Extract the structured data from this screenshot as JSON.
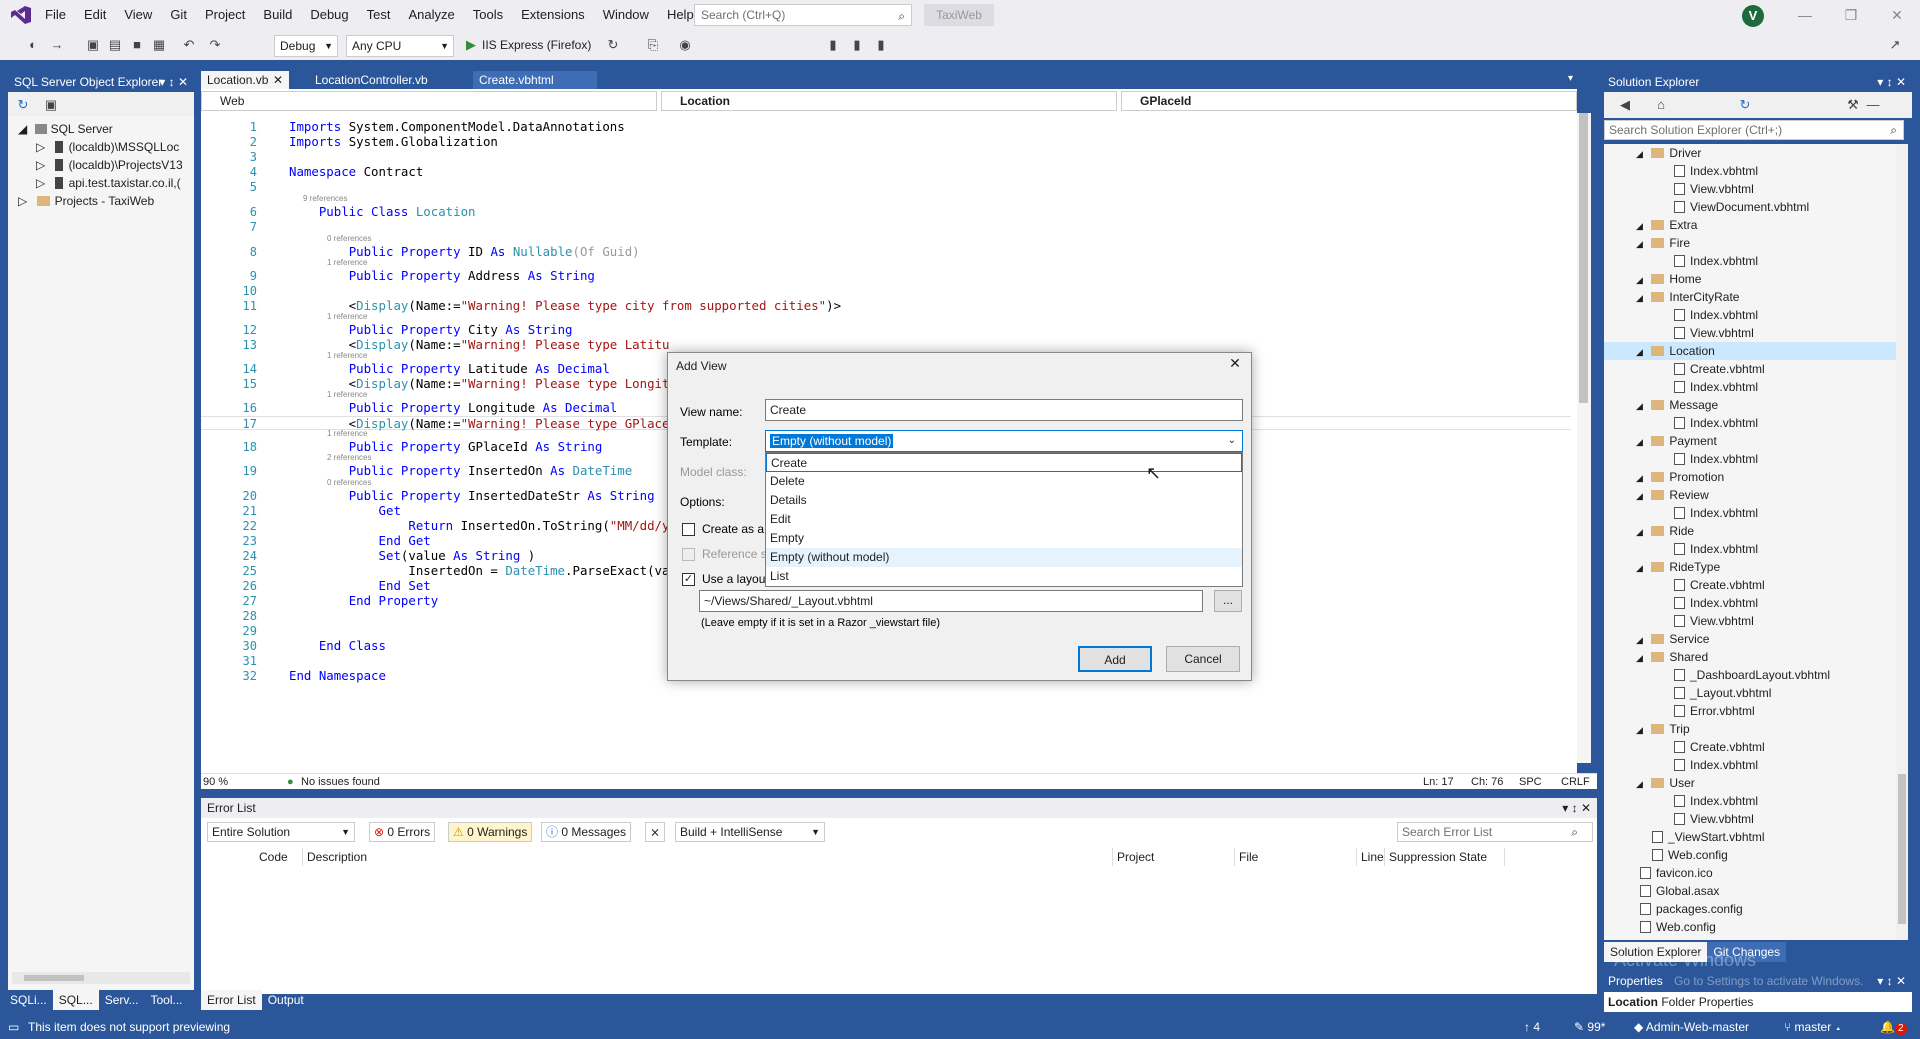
{
  "menu": [
    "File",
    "Edit",
    "View",
    "Git",
    "Project",
    "Build",
    "Debug",
    "Test",
    "Analyze",
    "Tools",
    "Extensions",
    "Window",
    "Help"
  ],
  "search": {
    "placeholder": "Search (Ctrl+Q)"
  },
  "app_title": "TaxiWeb",
  "avatar_initial": "V",
  "toolbar": {
    "config": "Debug",
    "platform": "Any CPU",
    "run_target": "IIS Express (Firefox)"
  },
  "sql_explorer": {
    "title": "SQL Server Object Explorer",
    "root": "SQL Server",
    "items": [
      "(localdb)\\MSSQLLoc",
      "(localdb)\\ProjectsV13",
      "api.test.taxistar.co.il,(",
      "Projects - TaxiWeb"
    ],
    "tabs": [
      "SQLi...",
      "SQL...",
      "Serv...",
      "Tool..."
    ]
  },
  "editor": {
    "tabs": [
      "Location.vb",
      "LocationController.vb",
      "Create.vbhtml"
    ],
    "nav": {
      "scope": "Web",
      "class": "Location",
      "member": "GPlaceId"
    },
    "zoom": "90 %",
    "issues": "No issues found",
    "position": {
      "line": "Ln: 17",
      "col": "Ch: 76",
      "ws": "SPC",
      "eol": "CRLF"
    },
    "lines": [
      {
        "n": "1",
        "segs": [
          [
            "kw",
            "Imports"
          ],
          [
            "",
            "System.ComponentModel.DataAnnotations"
          ]
        ]
      },
      {
        "n": "2",
        "segs": [
          [
            "kw",
            "Imports"
          ],
          [
            "",
            "System.Globalization"
          ]
        ]
      },
      {
        "n": "3",
        "segs": []
      },
      {
        "n": "4",
        "segs": [
          [
            "kw",
            "Namespace"
          ],
          [
            "",
            " Contract"
          ]
        ]
      },
      {
        "n": "5",
        "segs": []
      },
      {
        "n": "6",
        "segs": [
          [
            "",
            "    "
          ],
          [
            "kw",
            "Public Class"
          ],
          [
            "ty",
            " Location"
          ]
        ]
      },
      {
        "n": "7",
        "segs": []
      },
      {
        "n": "8",
        "segs": [
          [
            "",
            "        "
          ],
          [
            "kw",
            "Public Property"
          ],
          [
            "",
            " ID "
          ],
          [
            "kw",
            "As"
          ],
          [
            "ty",
            " Nullable"
          ],
          [
            "gr",
            "(Of Guid)"
          ]
        ]
      },
      {
        "n": "9",
        "segs": [
          [
            "",
            "        "
          ],
          [
            "kw",
            "Public Property"
          ],
          [
            "",
            " Address "
          ],
          [
            "kw",
            "As String"
          ]
        ]
      },
      {
        "n": "10",
        "segs": []
      },
      {
        "n": "11",
        "segs": [
          [
            "",
            "        <"
          ],
          [
            "ty",
            "Display"
          ],
          [
            "",
            "(Name:="
          ],
          [
            "st",
            "\"Warning! Please type city from supported cities\""
          ],
          [
            "",
            ")>"
          ]
        ]
      },
      {
        "n": "12",
        "segs": [
          [
            "",
            "        "
          ],
          [
            "kw",
            "Public Property"
          ],
          [
            "",
            " City "
          ],
          [
            "kw",
            "As String"
          ]
        ]
      },
      {
        "n": "13",
        "segs": [
          [
            "",
            "        <"
          ],
          [
            "ty",
            "Display"
          ],
          [
            "",
            "(Name:="
          ],
          [
            "st",
            "\"Warning! Please type Latitu"
          ]
        ]
      },
      {
        "n": "14",
        "segs": [
          [
            "",
            "        "
          ],
          [
            "kw",
            "Public Property"
          ],
          [
            "",
            " Latitude "
          ],
          [
            "kw",
            "As Decimal"
          ]
        ]
      },
      {
        "n": "15",
        "segs": [
          [
            "",
            "        <"
          ],
          [
            "ty",
            "Display"
          ],
          [
            "",
            "(Name:="
          ],
          [
            "st",
            "\"Warning! Please type Longit"
          ]
        ]
      },
      {
        "n": "16",
        "segs": [
          [
            "",
            "        "
          ],
          [
            "kw",
            "Public Property"
          ],
          [
            "",
            " Longitude "
          ],
          [
            "kw",
            "As Decimal"
          ]
        ]
      },
      {
        "n": "17",
        "segs": [
          [
            "",
            "        <"
          ],
          [
            "ty",
            "Display"
          ],
          [
            "",
            "(Name:="
          ],
          [
            "st",
            "\"Warning! Please type GPlace"
          ]
        ]
      },
      {
        "n": "18",
        "segs": [
          [
            "",
            "        "
          ],
          [
            "kw",
            "Public Property"
          ],
          [
            "",
            " GPlaceId "
          ],
          [
            "kw",
            "As String"
          ]
        ]
      },
      {
        "n": "19",
        "segs": [
          [
            "",
            "        "
          ],
          [
            "kw",
            "Public Property"
          ],
          [
            "",
            " InsertedOn "
          ],
          [
            "kw",
            "As"
          ],
          [
            "ty",
            " DateTime"
          ]
        ]
      },
      {
        "n": "20",
        "segs": [
          [
            "",
            "        "
          ],
          [
            "kw",
            "Public Property"
          ],
          [
            "",
            " InsertedDateStr "
          ],
          [
            "kw",
            "As String"
          ]
        ]
      },
      {
        "n": "21",
        "segs": [
          [
            "",
            "            "
          ],
          [
            "kw",
            "Get"
          ]
        ]
      },
      {
        "n": "22",
        "segs": [
          [
            "",
            "                "
          ],
          [
            "kw",
            "Return"
          ],
          [
            "",
            " InsertedOn.ToString("
          ],
          [
            "st",
            "\"MM/dd/y"
          ]
        ]
      },
      {
        "n": "23",
        "segs": [
          [
            "",
            "            "
          ],
          [
            "kw",
            "End Get"
          ]
        ]
      },
      {
        "n": "24",
        "segs": [
          [
            "",
            "            "
          ],
          [
            "kw",
            "Set"
          ],
          [
            "",
            "(value "
          ],
          [
            "kw",
            "As String"
          ],
          [
            "",
            ")"
          ]
        ]
      },
      {
        "n": "25",
        "segs": [
          [
            "",
            "                InsertedOn = "
          ],
          [
            "ty",
            "DateTime"
          ],
          [
            "",
            ".ParseExact(va"
          ]
        ]
      },
      {
        "n": "26",
        "segs": [
          [
            "",
            "            "
          ],
          [
            "kw",
            "End Set"
          ]
        ]
      },
      {
        "n": "27",
        "segs": [
          [
            "",
            "        "
          ],
          [
            "kw",
            "End Property"
          ]
        ]
      },
      {
        "n": "28",
        "segs": []
      },
      {
        "n": "29",
        "segs": []
      },
      {
        "n": "30",
        "segs": [
          [
            "",
            "    "
          ],
          [
            "kw",
            "End Class"
          ]
        ]
      },
      {
        "n": "31",
        "segs": []
      },
      {
        "n": "32",
        "segs": [
          [
            "kw",
            "End Namespace"
          ]
        ]
      }
    ],
    "refs": [
      {
        "after": "5",
        "text": "9 references"
      },
      {
        "after": "7",
        "text": "0 references"
      },
      {
        "after": "8",
        "text": "1 reference"
      },
      {
        "after": "11",
        "text": "1 reference"
      },
      {
        "after": "13",
        "text": "1 reference"
      },
      {
        "after": "15",
        "text": "1 reference"
      },
      {
        "after": "17",
        "text": "1 reference"
      },
      {
        "after": "18",
        "text": "2 references"
      },
      {
        "after": "19",
        "text": "0 references"
      }
    ]
  },
  "dialog": {
    "title": "Add View",
    "view_name_label": "View name:",
    "view_name": "Create",
    "template_label": "Template:",
    "template_selected": "Empty (without model)",
    "model_class_label": "Model class:",
    "options_label": "Options:",
    "create_partial": "Create as a p",
    "reference_scripts": "Reference sc",
    "use_layout": "Use a layout",
    "layout_path": "~/Views/Shared/_Layout.vbhtml",
    "browse": "...",
    "hint": "(Leave empty if it is set in a Razor _viewstart file)",
    "add": "Add",
    "cancel": "Cancel",
    "templates": [
      "Create",
      "Delete",
      "Details",
      "Edit",
      "Empty",
      "Empty (without model)",
      "List"
    ]
  },
  "error_list": {
    "title": "Error List",
    "scope": "Entire Solution",
    "errors": "0 Errors",
    "warnings": "0 Warnings",
    "messages": "0 Messages",
    "build": "Build + IntelliSense",
    "search_placeholder": "Search Error List",
    "columns": [
      "Code",
      "Description",
      "Project",
      "File",
      "Line",
      "Suppression State"
    ],
    "tabs": [
      "Error List",
      "Output"
    ]
  },
  "solution_explorer": {
    "title": "Solution Explorer",
    "search_placeholder": "Search Solution Explorer (Ctrl+;)",
    "items": [
      {
        "t": "Driver",
        "k": "folder",
        "lvl": 1
      },
      {
        "t": "Index.vbhtml",
        "k": "file",
        "lvl": 2
      },
      {
        "t": "View.vbhtml",
        "k": "file",
        "lvl": 2
      },
      {
        "t": "ViewDocument.vbhtml",
        "k": "file",
        "lvl": 2
      },
      {
        "t": "Extra",
        "k": "folder",
        "lvl": 1
      },
      {
        "t": "Fire",
        "k": "folder",
        "lvl": 1
      },
      {
        "t": "Index.vbhtml",
        "k": "file",
        "lvl": 2
      },
      {
        "t": "Home",
        "k": "folder",
        "lvl": 1
      },
      {
        "t": "InterCityRate",
        "k": "folder",
        "lvl": 1
      },
      {
        "t": "Index.vbhtml",
        "k": "file",
        "lvl": 2
      },
      {
        "t": "View.vbhtml",
        "k": "file",
        "lvl": 2
      },
      {
        "t": "Location",
        "k": "folder",
        "lvl": 1,
        "sel": true
      },
      {
        "t": "Create.vbhtml",
        "k": "file",
        "lvl": 2
      },
      {
        "t": "Index.vbhtml",
        "k": "file",
        "lvl": 2
      },
      {
        "t": "Message",
        "k": "folder",
        "lvl": 1
      },
      {
        "t": "Index.vbhtml",
        "k": "file",
        "lvl": 2
      },
      {
        "t": "Payment",
        "k": "folder",
        "lvl": 1
      },
      {
        "t": "Index.vbhtml",
        "k": "file",
        "lvl": 2
      },
      {
        "t": "Promotion",
        "k": "folder",
        "lvl": 1
      },
      {
        "t": "Review",
        "k": "folder",
        "lvl": 1
      },
      {
        "t": "Index.vbhtml",
        "k": "file",
        "lvl": 2
      },
      {
        "t": "Ride",
        "k": "folder",
        "lvl": 1
      },
      {
        "t": "Index.vbhtml",
        "k": "file",
        "lvl": 2
      },
      {
        "t": "RideType",
        "k": "folder",
        "lvl": 1
      },
      {
        "t": "Create.vbhtml",
        "k": "file",
        "lvl": 2
      },
      {
        "t": "Index.vbhtml",
        "k": "file",
        "lvl": 2
      },
      {
        "t": "View.vbhtml",
        "k": "file",
        "lvl": 2
      },
      {
        "t": "Service",
        "k": "folder",
        "lvl": 1
      },
      {
        "t": "Shared",
        "k": "folder",
        "lvl": 1
      },
      {
        "t": "_DashboardLayout.vbhtml",
        "k": "file",
        "lvl": 2
      },
      {
        "t": "_Layout.vbhtml",
        "k": "file",
        "lvl": 2
      },
      {
        "t": "Error.vbhtml",
        "k": "file",
        "lvl": 2
      },
      {
        "t": "Trip",
        "k": "folder",
        "lvl": 1
      },
      {
        "t": "Create.vbhtml",
        "k": "file",
        "lvl": 2
      },
      {
        "t": "Index.vbhtml",
        "k": "file",
        "lvl": 2
      },
      {
        "t": "User",
        "k": "folder",
        "lvl": 1
      },
      {
        "t": "Index.vbhtml",
        "k": "file",
        "lvl": 2
      },
      {
        "t": "View.vbhtml",
        "k": "file",
        "lvl": 2
      },
      {
        "t": "_ViewStart.vbhtml",
        "k": "file",
        "lvl": 1
      },
      {
        "t": "Web.config",
        "k": "file",
        "lvl": 1
      },
      {
        "t": "favicon.ico",
        "k": "file",
        "lvl": 0
      },
      {
        "t": "Global.asax",
        "k": "file",
        "lvl": 0
      },
      {
        "t": "packages.config",
        "k": "file",
        "lvl": 0
      },
      {
        "t": "Web.config",
        "k": "file",
        "lvl": 0
      }
    ],
    "tabs": [
      "Solution Explorer",
      "Git Changes"
    ],
    "watermark": "Activate Windows",
    "watermark_sub": "Go to Settings to activate Windows."
  },
  "properties": {
    "title": "Properties",
    "object": "Location",
    "type": "Folder Properties"
  },
  "statusbar": {
    "message": "This item does not support previewing",
    "up": "4",
    "edits": "99*",
    "repo": "Admin-Web-master",
    "branch": "master",
    "notifications": "2"
  }
}
